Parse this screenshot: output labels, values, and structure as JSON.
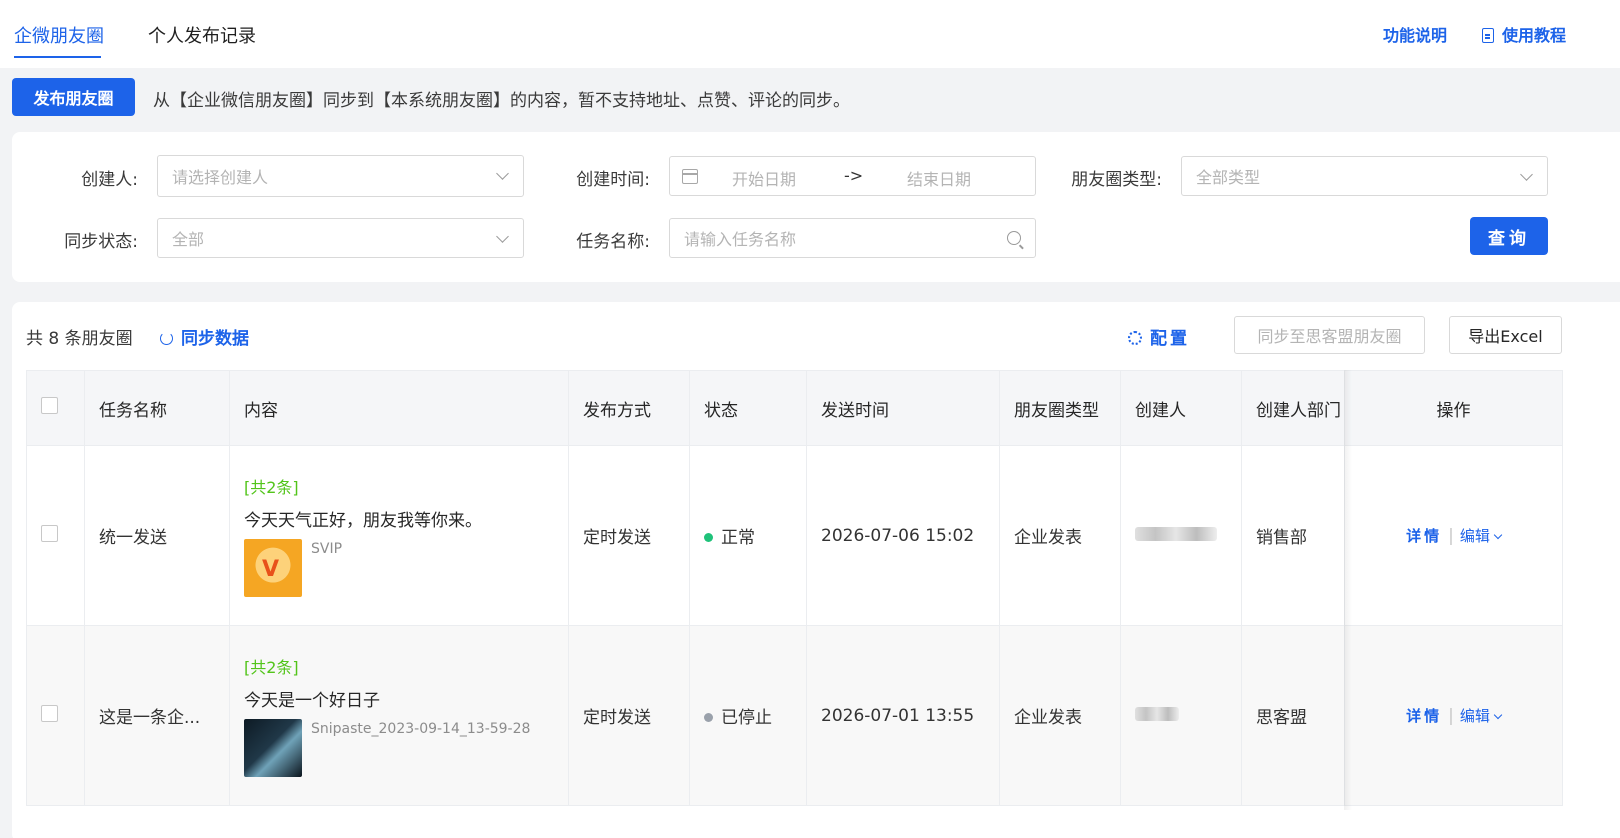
{
  "tabs": [
    {
      "label": "企微朋友圈",
      "active": true
    },
    {
      "label": "个人发布记录",
      "active": false
    }
  ],
  "top_links": {
    "feature_desc": "功能说明",
    "tutorial": "使用教程"
  },
  "publish_button": "发布朋友圈",
  "notice": "从【企业微信朋友圈】同步到【本系统朋友圈】的内容，暂不支持地址、点赞、评论的同步。",
  "filters": {
    "creator": {
      "label": "创建人:",
      "placeholder": "请选择创建人"
    },
    "created_time": {
      "label": "创建时间:",
      "start": "开始日期",
      "arrow": "->",
      "end": "结束日期"
    },
    "moment_type": {
      "label": "朋友圈类型:",
      "placeholder": "全部类型"
    },
    "sync_status": {
      "label": "同步状态:",
      "placeholder": "全部"
    },
    "task_name": {
      "label": "任务名称:",
      "placeholder": "请输入任务名称"
    },
    "query_button": "查询"
  },
  "toolbar": {
    "total": "共 8 条朋友圈",
    "sync_data": "同步数据",
    "config": "配置",
    "sync_to": "同步至思客盟朋友圈",
    "export": "导出Excel"
  },
  "table": {
    "columns": [
      "任务名称",
      "内容",
      "发布方式",
      "状态",
      "发送时间",
      "朋友圈类型",
      "创建人",
      "创建人部门",
      "操作"
    ],
    "rows": [
      {
        "task_name": "统一发送",
        "content_count": "[共2条]",
        "content_text": "今天天气正好，朋友我等你来。",
        "attachment_name": "SVIP",
        "publish_method": "定时发送",
        "status": "正常",
        "status_color": "#1fc27a",
        "send_time": "2026-07-06 15:02",
        "moment_type": "企业发表",
        "department": "销售部",
        "op_detail": "详情",
        "op_edit": "编辑"
      },
      {
        "task_name": "这是一条企...",
        "content_count": "[共2条]",
        "content_text": "今天是一个好日子",
        "attachment_name": "Snipaste_2023-09-14_13-59-28",
        "publish_method": "定时发送",
        "status": "已停止",
        "status_color": "#9aa1ab",
        "send_time": "2026-07-01 13:55",
        "moment_type": "企业发表",
        "department": "思客盟",
        "op_detail": "详情",
        "op_edit": "编辑"
      }
    ]
  },
  "colors": {
    "primary": "#1d63e9",
    "success_count": "#52c41a",
    "status_normal": "#1fc27a",
    "status_stopped": "#9aa1ab"
  }
}
